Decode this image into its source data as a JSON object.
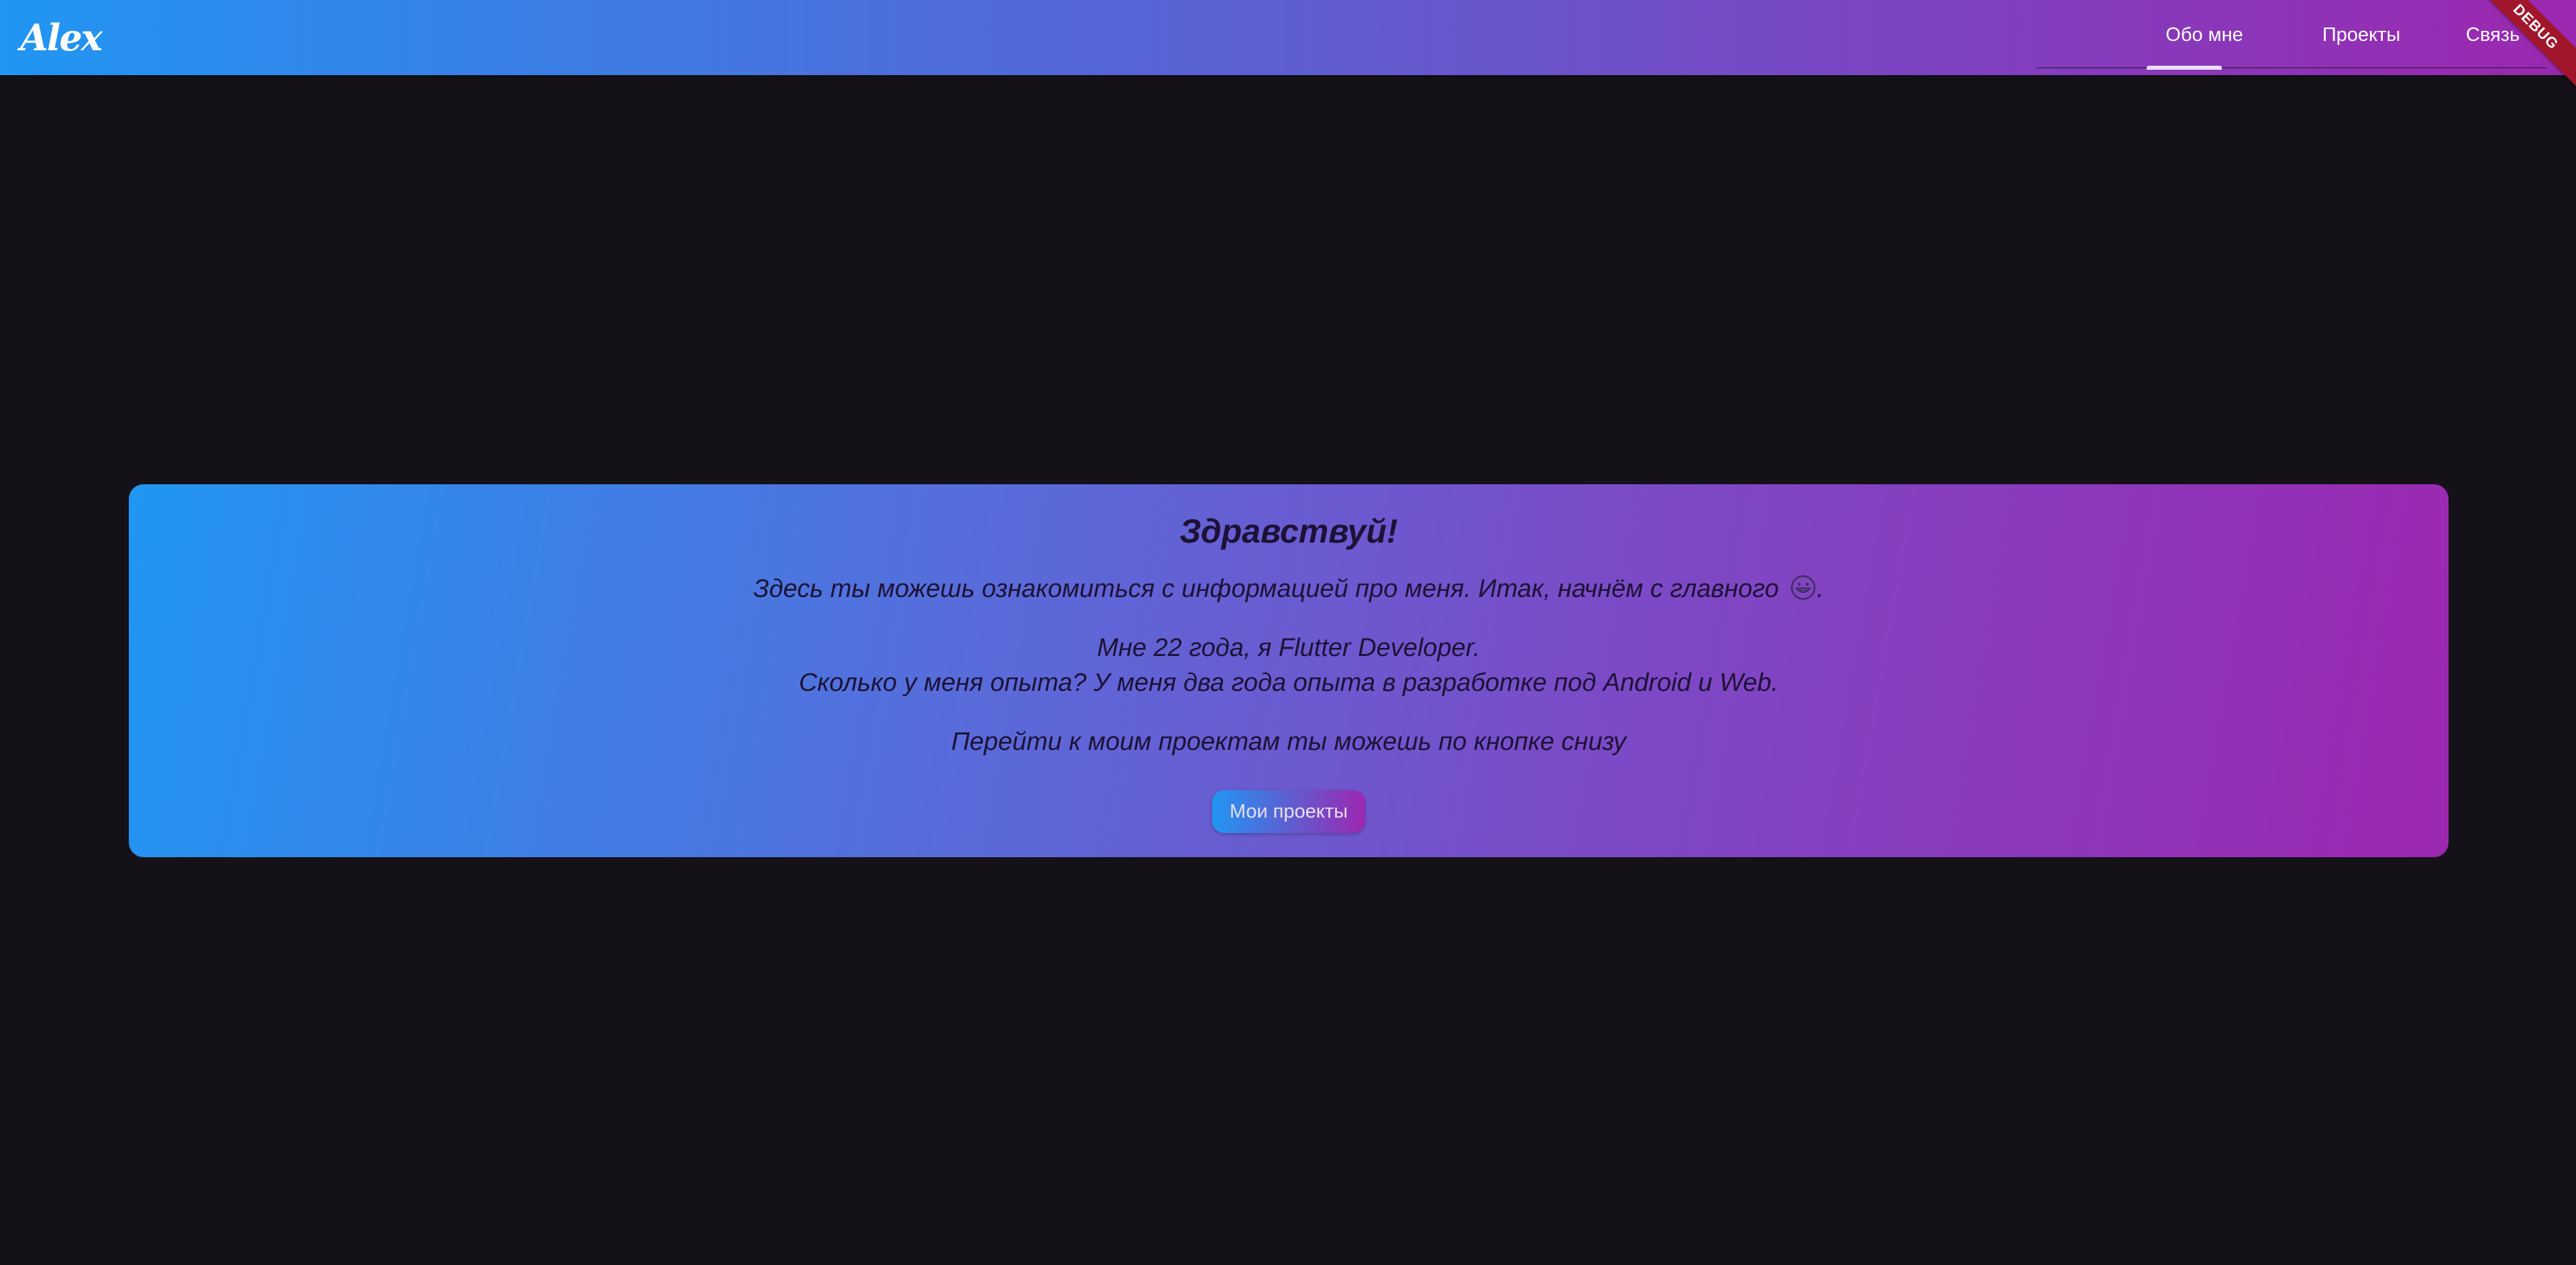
{
  "appbar": {
    "logo_text": "Alex",
    "tabs": [
      {
        "label": "Обо мне",
        "selected": true
      },
      {
        "label": "Проекты",
        "selected": false
      },
      {
        "label": "Связь",
        "selected": false
      }
    ],
    "debug_banner": "DEBUG"
  },
  "card": {
    "title": "Здравствуй!",
    "intro": "Здесь ты можешь ознакомиться с информацией про меня. Итак, начнём с главного",
    "intro_end": ".",
    "age_line": "Мне 22 года, я Flutter Developer.",
    "experience_line": "Сколько у меня опыта? У меня два года опыта в разработке под Android и Web.",
    "goto_line": "Перейти к моим проектам ты можешь по кнопке снизу",
    "button_label": "Мои проекты"
  },
  "icons": {
    "emoji": "grinning-face-icon"
  },
  "colors": {
    "gradient_start": "#2196f3",
    "gradient_end": "#9c27b0",
    "background": "#141218",
    "debug_banner": "#a1162b"
  }
}
